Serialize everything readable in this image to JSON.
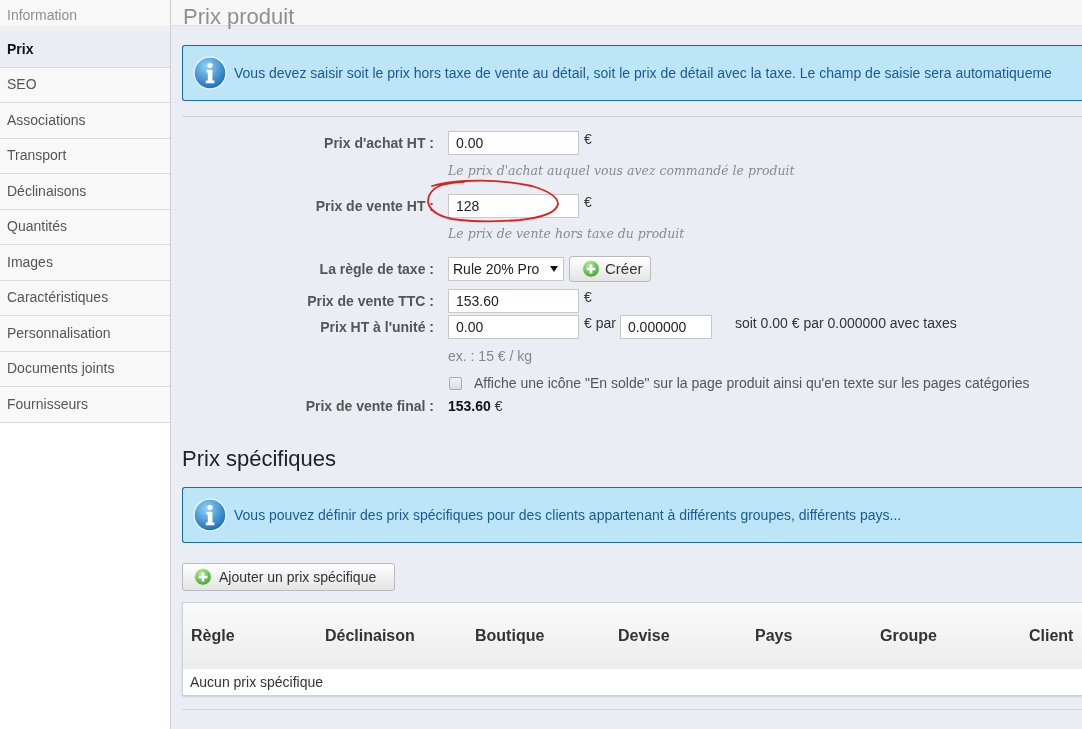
{
  "sidebar": {
    "items": [
      {
        "label": "Information",
        "selected": false
      },
      {
        "label": "Prix",
        "selected": true
      },
      {
        "label": "SEO",
        "selected": false
      },
      {
        "label": "Associations",
        "selected": false
      },
      {
        "label": "Transport",
        "selected": false
      },
      {
        "label": "Déclinaisons",
        "selected": false
      },
      {
        "label": "Quantités",
        "selected": false
      },
      {
        "label": "Images",
        "selected": false
      },
      {
        "label": "Caractéristiques",
        "selected": false
      },
      {
        "label": "Personnalisation",
        "selected": false
      },
      {
        "label": "Documents joints",
        "selected": false
      },
      {
        "label": "Fournisseurs",
        "selected": false
      }
    ]
  },
  "page_title": "Prix produit",
  "price_section": {
    "info": "Vous devez saisir soit le prix hors taxe de vente au détail, soit le prix de détail avec la taxe. Le champ de saisie sera automatiqueme",
    "fields": [
      {
        "kind": "input",
        "label": "Prix d'achat HT :",
        "value": "0.00",
        "unit": "€",
        "hint": "Le prix d'achat auquel vous avez commandé le produit"
      },
      {
        "kind": "input",
        "label": "Prix de vente HT :",
        "value": "128",
        "unit": "€",
        "hint": "Le prix de vente hors taxe du produit"
      },
      {
        "kind": "select",
        "label": "La règle de taxe :",
        "value": "Rule 20% Pro",
        "button": "Créer"
      },
      {
        "kind": "input",
        "label": "Prix de vente TTC :",
        "value": "153.60",
        "unit": "€"
      },
      {
        "kind": "unit_price",
        "label": "Prix HT à l'unité :",
        "value": "0.00",
        "unit": "€ par",
        "value_2": "0.000000",
        "summary": "soit 0.00 € par 0.000000 avec taxes",
        "hint": "ex. : 15 € / kg"
      },
      {
        "kind": "checkbox",
        "label": "Affiche une icône \"En solde\" sur la page produit ainsi qu'en texte sur les pages catégories",
        "checked": false
      },
      {
        "kind": "total",
        "label": "Prix de vente final :",
        "value": "153.60",
        "unit": "€"
      }
    ]
  },
  "specific_prices": {
    "title": "Prix spécifiques",
    "info": "Vous pouvez définir des prix spécifiques pour des clients appartenant à différents groupes, différents pays...",
    "add_button": "Ajouter un prix spécifique",
    "table": {
      "columns": [
        "Règle",
        "Déclinaison",
        "Boutique",
        "Devise",
        "Pays",
        "Groupe",
        "Client"
      ],
      "empty_message": "Aucun prix spécifique"
    }
  }
}
